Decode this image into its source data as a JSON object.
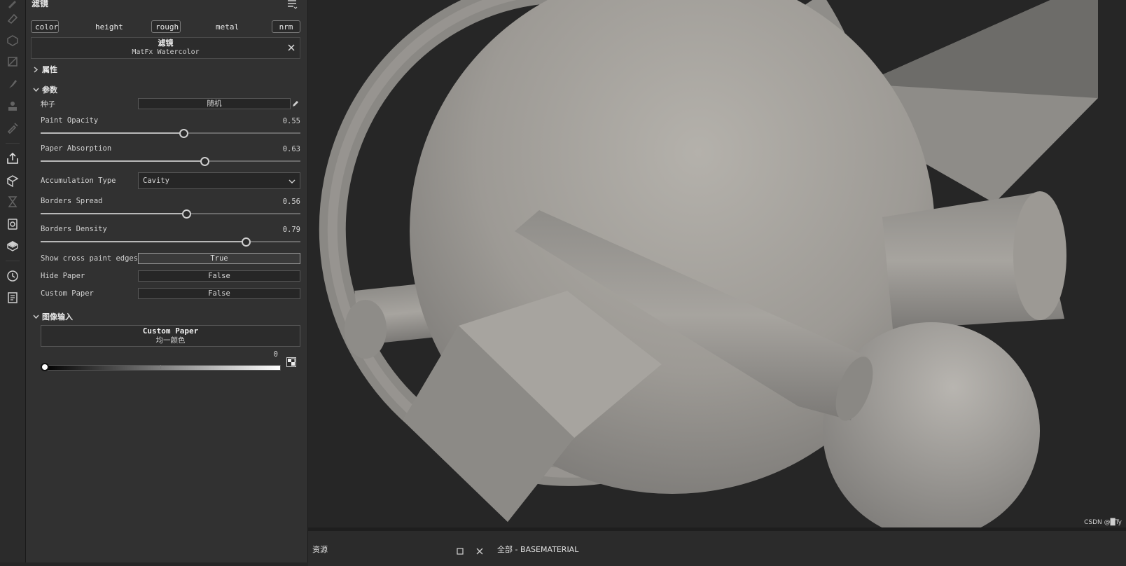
{
  "panel": {
    "title": "滤镜",
    "channels": [
      "color",
      "height",
      "rough",
      "metal",
      "nrm"
    ],
    "filter": {
      "heading": "滤镜",
      "name": "MatFx Watercolor"
    },
    "sections": {
      "attributes": "属性",
      "params": "参数",
      "image_input": "图像输入"
    },
    "seed": {
      "label": "种子",
      "value": "随机"
    },
    "sliders": [
      {
        "label": "Paint Opacity",
        "value": "0.55",
        "fraction": 0.55
      },
      {
        "label": "Paper Absorption",
        "value": "0.63",
        "fraction": 0.63
      },
      {
        "label": "Borders Spread",
        "value": "0.56",
        "fraction": 0.56
      },
      {
        "label": "Borders Density",
        "value": "0.79",
        "fraction": 0.79
      }
    ],
    "accumulation": {
      "label": "Accumulation Type",
      "value": "Cavity"
    },
    "toggles": [
      {
        "label": "Show cross paint edges",
        "value": "True"
      },
      {
        "label": "Hide Paper",
        "value": "False"
      },
      {
        "label": "Custom Paper",
        "value": "False"
      }
    ],
    "image": {
      "title": "Custom Paper",
      "mode": "均一颜色",
      "value": "0"
    }
  },
  "dock": {
    "left_tab": "资源",
    "right_tab": "全部 - BASEMATERIAL"
  },
  "watermark": "CSDN @█Ty",
  "toolstrip_icons": [
    "eraser-icon",
    "projection-icon",
    "polygon-fill-icon",
    "smudge-icon",
    "clone-stamp-icon",
    "picker-icon",
    "export-icon",
    "bake-icon",
    "hourglass-icon",
    "texture-set-icon",
    "cube-icon",
    "history-icon",
    "log-icon"
  ]
}
